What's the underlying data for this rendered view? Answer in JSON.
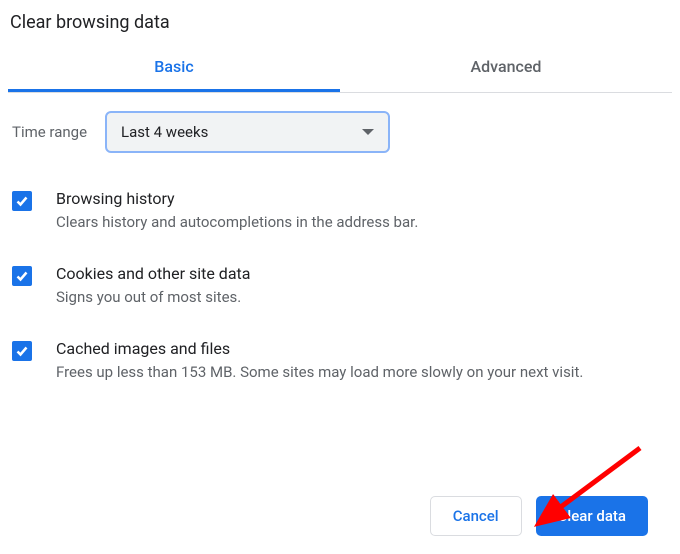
{
  "dialog": {
    "title": "Clear browsing data",
    "tabs": {
      "basic": "Basic",
      "advanced": "Advanced"
    },
    "time_range": {
      "label": "Time range",
      "selected": "Last 4 weeks"
    },
    "options": [
      {
        "title": "Browsing history",
        "desc": "Clears history and autocompletions in the address bar.",
        "checked": true
      },
      {
        "title": "Cookies and other site data",
        "desc": "Signs you out of most sites.",
        "checked": true
      },
      {
        "title": "Cached images and files",
        "desc": "Frees up less than 153 MB. Some sites may load more slowly on your next visit.",
        "checked": true
      }
    ],
    "buttons": {
      "cancel": "Cancel",
      "clear": "Clear data"
    }
  },
  "annotation": {
    "arrow_color": "#ff0000"
  }
}
